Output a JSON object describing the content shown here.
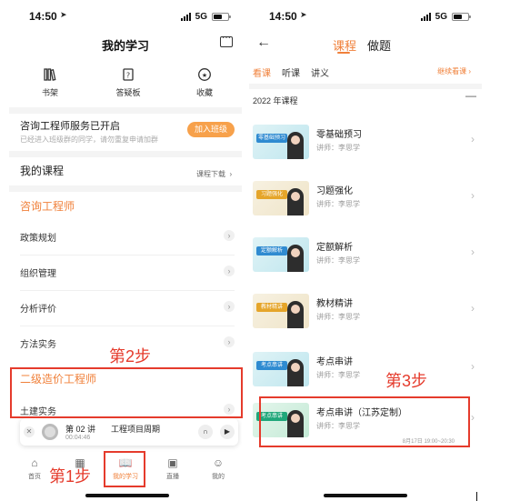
{
  "left": {
    "status": {
      "time": "14:50",
      "network": "5G"
    },
    "header": {
      "title": "我的学习",
      "message_icon": "message-icon"
    },
    "quick_actions": [
      {
        "label": "书架",
        "icon": "bookshelf-icon"
      },
      {
        "label": "答疑板",
        "icon": "question-board-icon"
      },
      {
        "label": "收藏",
        "icon": "star-icon"
      }
    ],
    "notice": {
      "title": "咨询工程师服务已开启",
      "subtitle": "已经进入班级群的同学，请勿重复申请加群",
      "button": "加入班级"
    },
    "my_courses": {
      "title": "我的课程",
      "more": "课程下载"
    },
    "section1": {
      "title": "咨询工程师",
      "items": [
        "政策规划",
        "组织管理",
        "分析评价",
        "方法实务"
      ]
    },
    "section2": {
      "title": "二级造价工程师",
      "items": [
        "土建实务"
      ]
    },
    "player": {
      "lesson": "第 02 讲",
      "name": "工程项目周期",
      "time": "00:04:46"
    },
    "tabbar": [
      {
        "label": "首页",
        "icon": "home-icon"
      },
      {
        "label": "",
        "icon": "grid-icon"
      },
      {
        "label": "我的学习",
        "icon": "book-icon"
      },
      {
        "label": "直播",
        "icon": "live-icon"
      },
      {
        "label": "我的",
        "icon": "user-icon"
      }
    ],
    "steps": {
      "step1": "第1步",
      "step2": "第2步"
    }
  },
  "right": {
    "status": {
      "time": "14:50",
      "network": "5G"
    },
    "top_tabs": [
      "课程",
      "做题"
    ],
    "sub_tabs": [
      "看课",
      "听课",
      "讲义"
    ],
    "continue": "继续看课 ›",
    "year": "2022 年课程",
    "courses": [
      {
        "title": "零基础预习",
        "teacher": "讲师：李思学",
        "thumb": "零基础预习",
        "style": "blue"
      },
      {
        "title": "习题强化",
        "teacher": "讲师：李思学",
        "thumb": "习题强化",
        "style": "gold"
      },
      {
        "title": "定额解析",
        "teacher": "讲师：李思学",
        "thumb": "定额解析",
        "style": "blue"
      },
      {
        "title": "教材精讲",
        "teacher": "讲师：李思学",
        "thumb": "教材精讲",
        "style": "gold"
      },
      {
        "title": "考点串讲",
        "teacher": "讲师：李思学",
        "thumb": "考点串讲",
        "style": "blue"
      },
      {
        "title": "考点串讲（江苏定制）",
        "teacher": "讲师：李思学",
        "thumb": "考点串讲",
        "style": "green",
        "date": "8月17日 19:00~20:30"
      }
    ],
    "steps": {
      "step3": "第3步"
    }
  }
}
